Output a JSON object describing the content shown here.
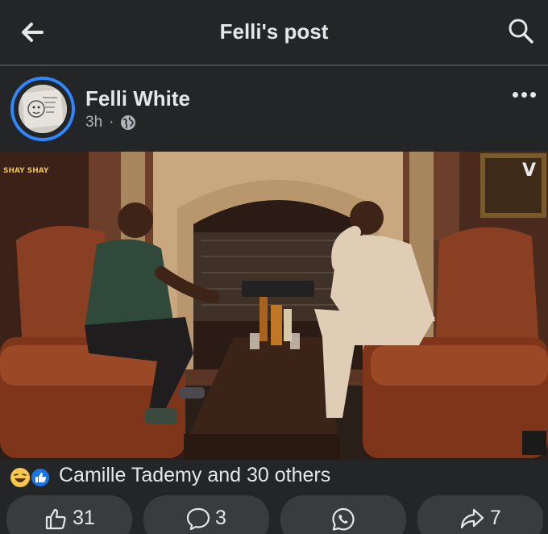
{
  "topbar": {
    "title": "Felli's post"
  },
  "post": {
    "author": "Felli White",
    "time": "3h",
    "separator": "·",
    "privacy_icon": "globe-icon"
  },
  "media": {
    "watermark_left": "SHAY SHAY",
    "watermark_right": "V",
    "description_icon": "video-thumbnail"
  },
  "reactions": {
    "label": "Camille Tademy and 30 others",
    "icons": [
      "laugh-emoji-icon",
      "like-icon"
    ]
  },
  "actions": {
    "like_count": "31",
    "comment_count": "3",
    "share_count": "7"
  },
  "colors": {
    "background": "#242526",
    "accent": "#2d88ff",
    "pill": "#3a3b3c",
    "text": "#e4e6eb",
    "muted": "#b0b3b8"
  }
}
